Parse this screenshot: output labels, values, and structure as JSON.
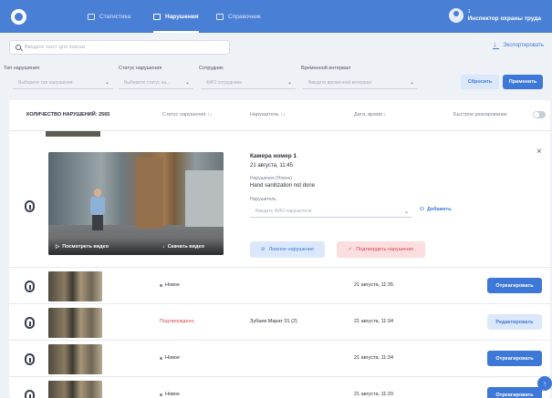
{
  "nav": {
    "tabs": [
      {
        "label": "Статистика",
        "icon": "chart-icon"
      },
      {
        "label": "Нарушения",
        "icon": "violations-icon"
      },
      {
        "label": "Справочник",
        "icon": "book-icon"
      }
    ],
    "user": {
      "line1": "1",
      "line2": "Инспектор охраны труда"
    }
  },
  "search": {
    "placeholder": "Введите текст для поиска"
  },
  "export_label": "Экспортировать",
  "filters": {
    "type": {
      "label": "Тип нарушения",
      "placeholder": "Выберите тип нарушения"
    },
    "status": {
      "label": "Статус нарушения",
      "placeholder": "Выберите статус на..."
    },
    "employee": {
      "label": "Сотрудник",
      "placeholder": "ФИО сотрудника"
    },
    "interval": {
      "label": "Временной интервал",
      "placeholder": "Введите временной интервал"
    },
    "reset_label": "Сбросить",
    "apply_label": "Применить"
  },
  "table": {
    "count_label": "КОЛИЧЕСТВО НАРУШЕНИЙ: 2565",
    "col_status": "Статус нарушения ↑↓",
    "col_violator": "Нарушитель ↑↓",
    "col_date": "Дата, время ↓",
    "fast_react": "Быстрое реагирование"
  },
  "detail": {
    "camera": "Камера номер 1",
    "datetime": "21 августа, 11:45",
    "violation_label": "Нарушения (Новое)",
    "violation_text": "Hand sanitization not done",
    "violator_label": "Нарушитель",
    "violator_placeholder": "Введите ФИО нарушителя",
    "add_label": "Добавить",
    "watch_label": "Посмотреть видео",
    "download_label": "Скачать видео",
    "false_label": "Ложное нарушение",
    "confirm_label": "Подтвердить нарушение"
  },
  "rows": [
    {
      "status": "Новое",
      "violator": "",
      "date": "21 августа, 11:35",
      "action": "Отреагировать"
    },
    {
      "status": "Подтверждено",
      "violator": "Зубаев Марат 01 (2)",
      "date": "21 августа, 11:34",
      "action": "Редактировать"
    },
    {
      "status": "Новое",
      "violator": "",
      "date": "21 августа, 11:34",
      "action": "Отреагировать"
    },
    {
      "status": "Новое",
      "violator": "",
      "date": "21 августа, 11:20",
      "action": "Отреагировать"
    }
  ],
  "colors": {
    "accent": "#3d78d8",
    "topbar": "#4a7fd6",
    "confirmed": "#d94a4f"
  }
}
